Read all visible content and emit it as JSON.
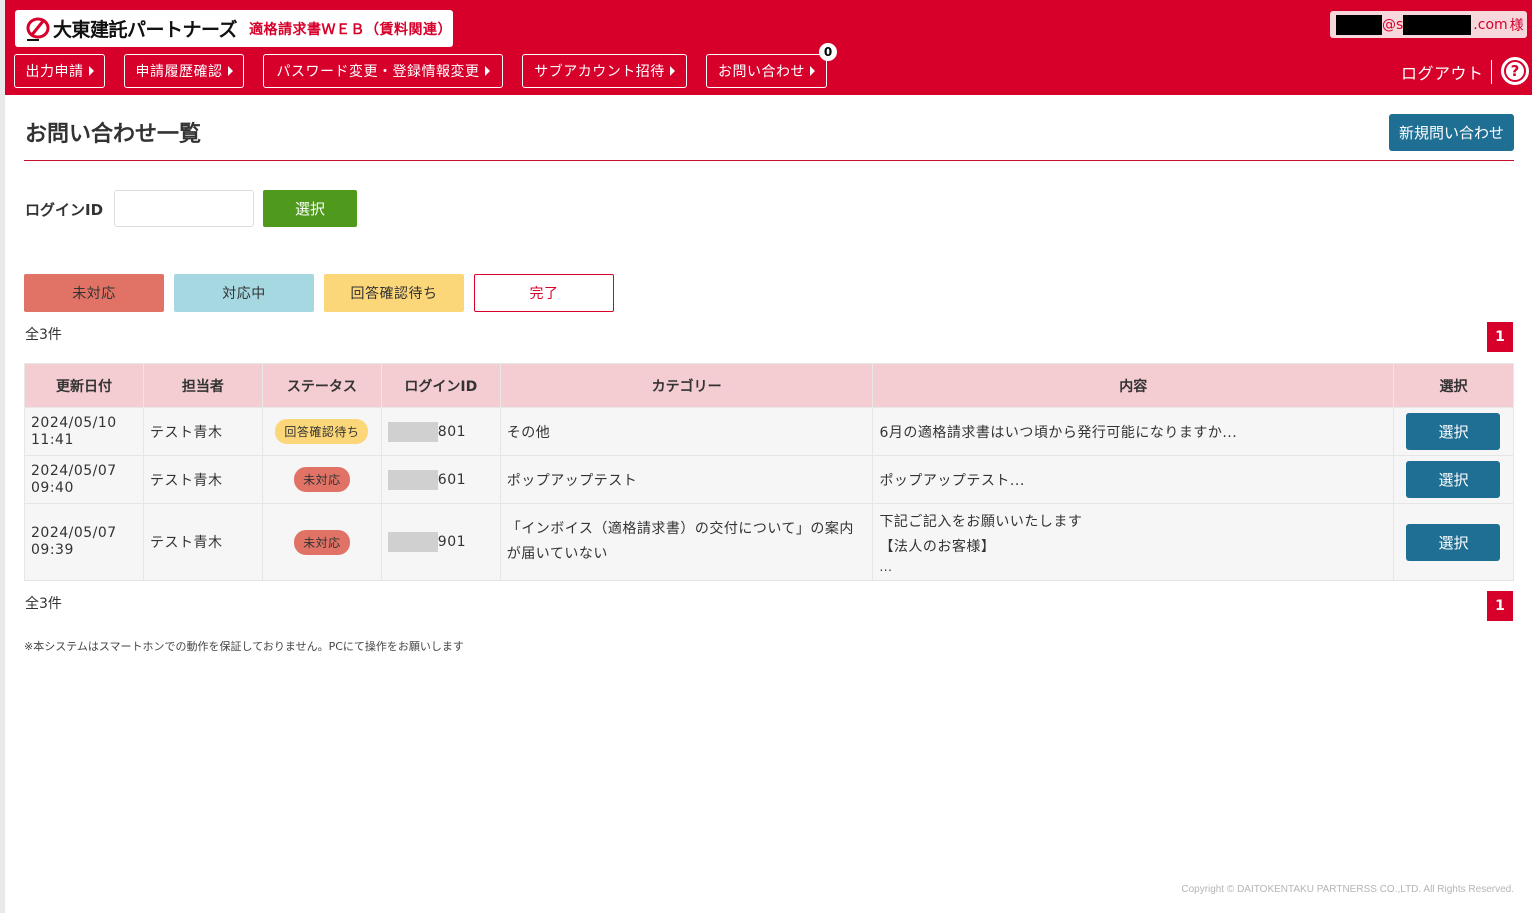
{
  "brand": {
    "name": "大東建託パートナーズ",
    "service": "適格請求書ＷＥＢ（賃料関連）"
  },
  "user": {
    "email_visible_at": "@s",
    "email_visible_tail": ".com",
    "honorific": "様"
  },
  "nav": {
    "items": [
      {
        "label": "出力申請"
      },
      {
        "label": "申請履歴確認"
      },
      {
        "label": "パスワード変更・登録情報変更"
      },
      {
        "label": "サブアカウント招待"
      },
      {
        "label": "お問い合わせ"
      }
    ],
    "inquiry_badge": "0",
    "logout": "ログアウト",
    "help": "?"
  },
  "page": {
    "title": "お問い合わせ一覧",
    "new_button": "新規問い合わせ"
  },
  "filter": {
    "login_label": "ログインID",
    "login_value": "",
    "select_button": "選択"
  },
  "status_filters": [
    "未対応",
    "対応中",
    "回答確認待ち",
    "完了"
  ],
  "summary": {
    "count_top": "全3件",
    "count_bottom": "全3件",
    "page": "1"
  },
  "table": {
    "headers": [
      "更新日付",
      "担当者",
      "ステータス",
      "ログインID",
      "カテゴリー",
      "内容",
      "選択"
    ],
    "rows": [
      {
        "date": "2024/05/10",
        "time": "11:41",
        "person": "テスト青木",
        "status": "回答確認待ち",
        "login_tail": "801",
        "category": "その他",
        "content": "6月の適格請求書はいつ頃から発行可能になりますか...",
        "select": "選択"
      },
      {
        "date": "2024/05/07",
        "time": "09:40",
        "person": "テスト青木",
        "status": "未対応",
        "login_tail": "601",
        "category": "ポップアップテスト",
        "content": "ポップアップテスト...",
        "select": "選択"
      },
      {
        "date": "2024/05/07",
        "time": "09:39",
        "person": "テスト青木",
        "status": "未対応",
        "login_tail": "901",
        "category": "「インボイス（適格請求書）の交付について」の案内が届いていない",
        "content_line1": "下記ご記入をお願いいたします",
        "content_line2": "【法人のお客様】",
        "content_line3": "...",
        "select": "選択"
      }
    ]
  },
  "footer": {
    "note": "※本システムはスマートホンでの動作を保証しておりません。PCにて操作をお願いします",
    "copyright": "Copyright © DAITOKENTAKU PARTNERSS CO.,LTD. All Rights Reserved."
  },
  "colors": {
    "brand_red": "#d6002b",
    "primary_blue": "#1f6f95",
    "green": "#4f9a1c",
    "status_unhandled": "#e07366",
    "status_inprogress": "#a6d8e1",
    "status_waiting": "#fbd77a",
    "table_header": "#f4cdd3"
  }
}
